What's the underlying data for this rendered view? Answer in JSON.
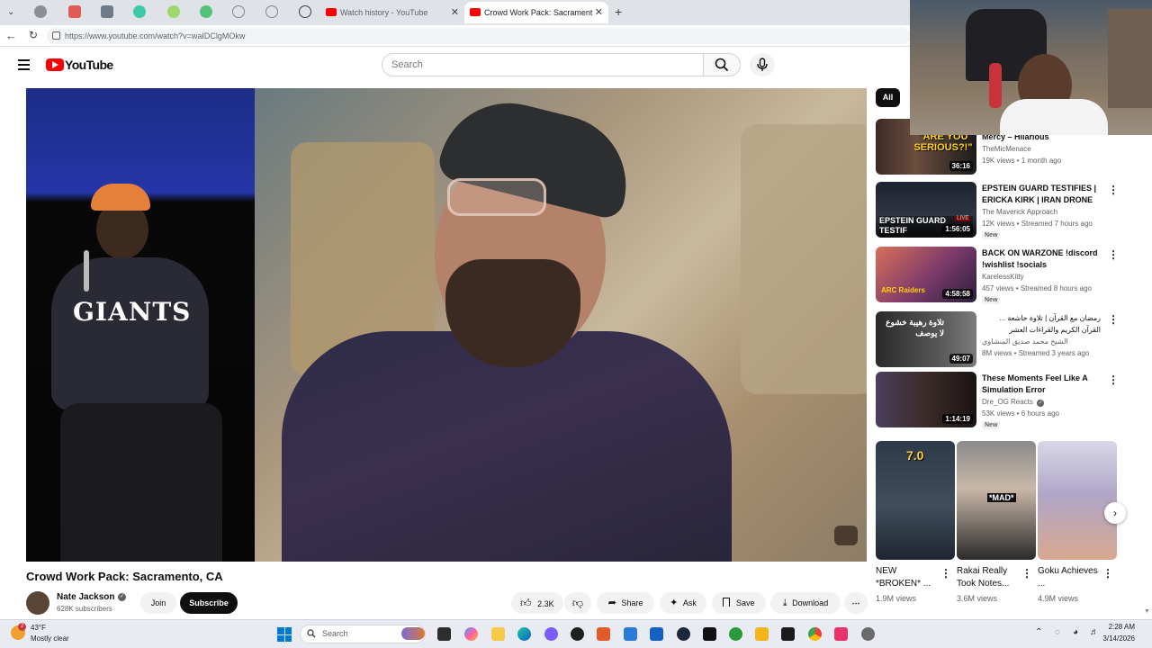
{
  "browser": {
    "tabs": [
      {
        "label": "Watch history - YouTube",
        "active": false
      },
      {
        "label": "Crowd Work Pack: Sacramento, CA",
        "active": true
      }
    ],
    "new_tab_icon": "plus-icon",
    "url": "https://www.youtube.com/watch?v=waIDClgMOkw"
  },
  "header": {
    "logo_text": "YouTube",
    "search_placeholder": "Search"
  },
  "video": {
    "title": "Crowd Work Pack: Sacramento, CA",
    "channel": "Nate Jackson",
    "subscribers": "628K subscribers",
    "join_label": "Join",
    "subscribe_label": "Subscribe",
    "likes": "2.3K",
    "share_label": "Share",
    "ask_label": "Ask",
    "save_label": "Save",
    "download_label": "Download"
  },
  "sidebar": {
    "chip_all": "All",
    "recommendations": [
      {
        "title": "Mercy – Hilarious Compilation...",
        "channel": "TheMicMenace",
        "meta": "19K views • 1 month ago",
        "duration": "36:16",
        "thumb_text": "\"ARE YOU SERIOUS?!\"",
        "new": ""
      },
      {
        "title": "EPSTEIN GUARD TESTIFIES | ERICKA KIRK | IRAN DRONE ...",
        "channel": "The Maverick Approach",
        "meta": "12K views • Streamed 7 hours ago",
        "duration": "1:56:05",
        "thumb_text": "EPSTEIN GUARD TESTIF",
        "live_text": "LIVE",
        "new": "New"
      },
      {
        "title": "BACK ON WARZONE !discord !wishlist !socials",
        "channel": "KarelessKitty",
        "meta": "457 views • Streamed 8 hours ago",
        "duration": "4:58:58",
        "thumb_text": "ARC Raiders",
        "new": "New"
      },
      {
        "title": "رمضان مع القرآن | تلاوة خاشعة ... القرآن الكريم والقراءات العشر",
        "channel": "الشيخ محمد صديق المنشاوي",
        "meta": "8M views • Streamed 3 years ago",
        "duration": "49:07",
        "thumb_text": "تلاوة رهيبة خشوع لا يوصف",
        "new": ""
      },
      {
        "title": "These Moments Feel Like A Simulation Error",
        "channel": "Dre_OG Reacts",
        "meta": "53K views • 6 hours ago",
        "duration": "1:14:19",
        "thumb_text": "",
        "new": "New"
      }
    ],
    "shorts": [
      {
        "title": "NEW *BROKEN* ...",
        "views": "1.9M views",
        "thumb_text": "7.0"
      },
      {
        "title": "Rakai Really Took Notes...",
        "views": "3.6M views",
        "thumb_text": "*MAD*"
      },
      {
        "title": "Goku Achieves ...",
        "views": "4.9M views",
        "thumb_text": ""
      }
    ]
  },
  "taskbar": {
    "weather_temp": "43°F",
    "weather_desc": "Mostly clear",
    "search_label": "Search",
    "time": "2:28 AM",
    "date": "3/14/2026",
    "notification_count": "2"
  },
  "colors": {
    "brand_red": "#ff0000",
    "text_primary": "#0f0f0f",
    "text_secondary": "#606060",
    "chip_bg": "#f2f2f2"
  }
}
